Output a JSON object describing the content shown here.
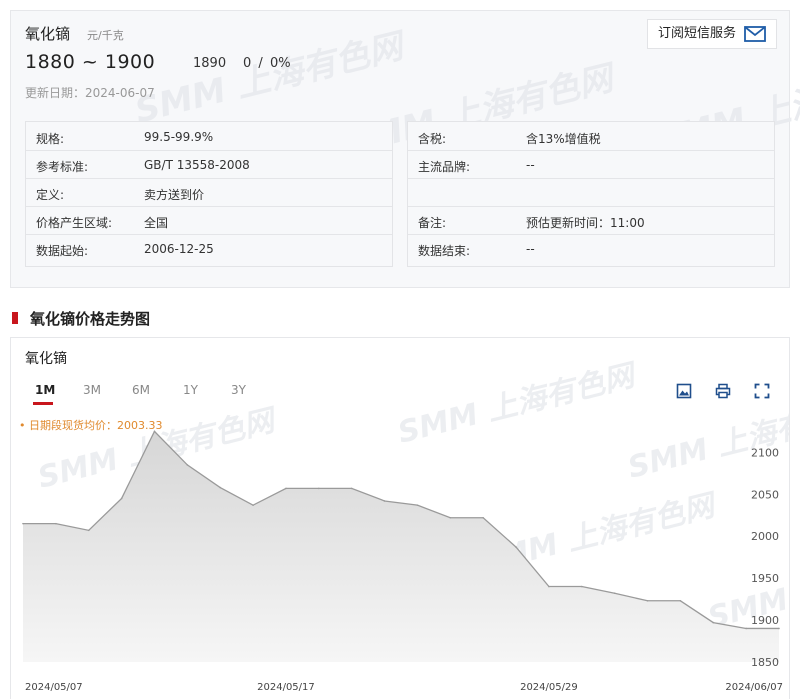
{
  "product": {
    "name": "氧化镝",
    "unit": "元/千克",
    "price_range": "1880 ~ 1900",
    "price_mid": "1890",
    "change": "0",
    "change_sep": "/",
    "change_pct": "0%",
    "update_label": "更新日期：",
    "update_date": "2024-06-07",
    "subscribe_label": "订阅短信服务"
  },
  "specs_left": [
    {
      "key": "规格:",
      "value": "99.5-99.9%"
    },
    {
      "key": "参考标准:",
      "value": "GB/T 13558-2008"
    },
    {
      "key": "定义:",
      "value": "卖方送到价"
    },
    {
      "key": "价格产生区域:",
      "value": "全国"
    },
    {
      "key": "数据起始:",
      "value": "2006-12-25"
    }
  ],
  "specs_right": [
    {
      "key": "含税:",
      "value": "含13%增值税"
    },
    {
      "key": "主流品牌:",
      "value": "--"
    },
    {
      "key": "",
      "value": ""
    },
    {
      "key": "备注:",
      "value": "预估更新时间：11:00"
    },
    {
      "key": "数据结束:",
      "value": "--"
    }
  ],
  "watermark": "SMM 上海有色网",
  "section_title": "氧化镝价格走势图",
  "chart": {
    "name": "氧化镝",
    "tabs": [
      "1M",
      "3M",
      "6M",
      "1Y",
      "3Y"
    ],
    "active_tab": "1M",
    "avg_label": "• 日期段现货均价：2003.33",
    "icons": [
      "image-export-icon",
      "print-icon",
      "fullscreen-icon"
    ]
  },
  "colors": {
    "accent": "#c8161d",
    "line": "#9a9a9a",
    "area_top": "#d9d9d9",
    "area_bottom": "#f4f4f4",
    "avg_text": "#e08a2e"
  },
  "chart_data": {
    "type": "area",
    "x": [
      "2024/05/07",
      "2024/05/08",
      "2024/05/09",
      "2024/05/10",
      "2024/05/13",
      "2024/05/14",
      "2024/05/15",
      "2024/05/16",
      "2024/05/17",
      "2024/05/20",
      "2024/05/21",
      "2024/05/22",
      "2024/05/23",
      "2024/05/24",
      "2024/05/27",
      "2024/05/28",
      "2024/05/29",
      "2024/05/30",
      "2024/05/31",
      "2024/06/03",
      "2024/06/04",
      "2024/06/05",
      "2024/06/06",
      "2024/06/07"
    ],
    "y": [
      2015,
      2015,
      2007,
      2045,
      2125,
      2085,
      2058,
      2037,
      2057,
      2057,
      2057,
      2042,
      2037,
      2022,
      2022,
      1987,
      1940,
      1940,
      1932,
      1923,
      1923,
      1897,
      1890,
      1890
    ],
    "xticks": [
      "2024/05/07",
      "2024/05/17",
      "2024/05/29",
      "2024/06/07"
    ],
    "yticks": [
      1850,
      1900,
      1950,
      2000,
      2050,
      2100
    ],
    "ylim": [
      1850,
      2125
    ],
    "title": "",
    "xlabel": "",
    "ylabel": "",
    "grid": false,
    "legend": false
  }
}
